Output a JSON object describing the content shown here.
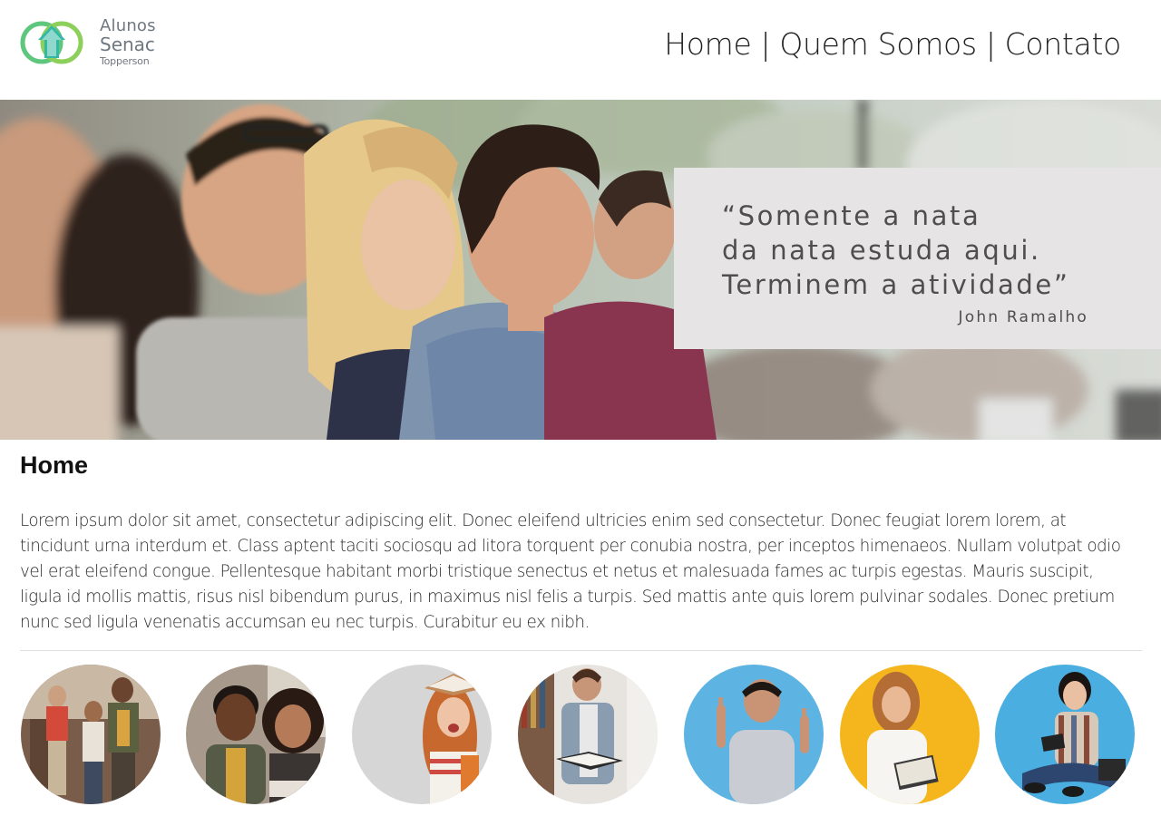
{
  "logo": {
    "line1": "Alunos",
    "line2": "Senac",
    "line3": "Topperson",
    "colors": {
      "green": "#4dbf6a",
      "teal": "#2eb6a4"
    }
  },
  "nav": {
    "items": [
      {
        "label": "Home"
      },
      {
        "label": "Quem Somos"
      },
      {
        "label": "Contato"
      }
    ],
    "separator": "|"
  },
  "hero": {
    "quote": "“Somente a nata\nda nata estuda aqui.\nTerminem a atividade”",
    "author": "John Ramalho"
  },
  "main": {
    "title": "Home",
    "paragraph": "Lorem ipsum dolor sit amet, consectetur adipiscing elit. Donec eleifend ultricies enim sed consectetur. Donec feugiat lorem lorem, at tincidunt urna interdum et. Class aptent taciti sociosqu ad litora torquent per conubia nostra, per inceptos himenaeos. Nullam volutpat odio vel erat eleifend congue. Pellentesque habitant morbi tristique senectus et netus et malesuada fames ac turpis egestas. Mauris suscipit, ligula id mollis mattis, risus nisl bibendum purus, in maximus nisl felis a turpis. Sed mattis ante quis lorem pulvinar sodales. Donec pretium nunc sed ligula venenatis accumsan eu nec turpis. Curabitur eu ex nibh."
  },
  "gallery": {
    "photos": [
      {
        "subject": "group-walking-students-photo",
        "bg": "#8c6a55"
      },
      {
        "subject": "two-smiling-students-photo",
        "bg": "#b8a89a"
      },
      {
        "subject": "girl-with-book-on-head-photo",
        "bg": "#d9d9d9"
      },
      {
        "subject": "student-reading-in-library-photo",
        "bg": "#e4e1dc"
      },
      {
        "subject": "student-pointing-up-photo",
        "bg": "#5ab0e0"
      },
      {
        "subject": "student-with-books-photo",
        "bg": "#f2b31c"
      },
      {
        "subject": "student-sitting-with-tablet-photo",
        "bg": "#4aaee0"
      }
    ]
  }
}
